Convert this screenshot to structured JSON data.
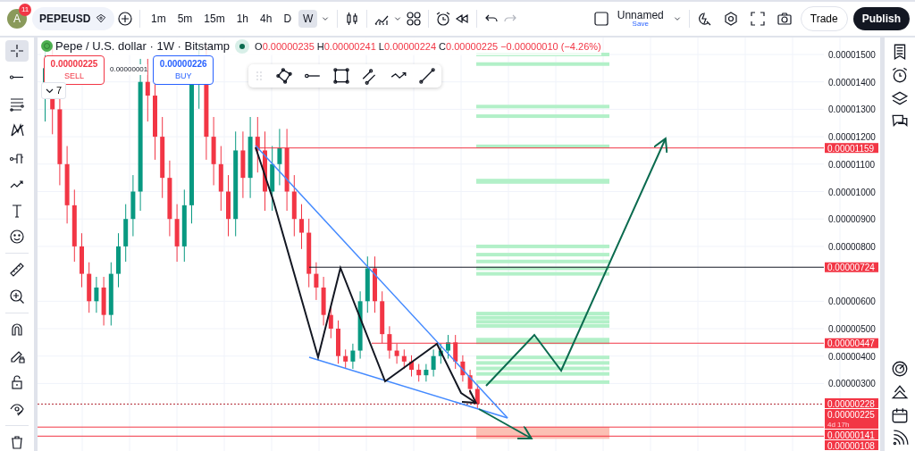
{
  "account": {
    "initial": "A",
    "notifications": "11"
  },
  "symbol": {
    "value": "PEPEUSD"
  },
  "timeframes": [
    {
      "label": "1m",
      "selected": false
    },
    {
      "label": "5m",
      "selected": false
    },
    {
      "label": "15m",
      "selected": false
    },
    {
      "label": "1h",
      "selected": false
    },
    {
      "label": "4h",
      "selected": false
    },
    {
      "label": "D",
      "selected": false
    },
    {
      "label": "W",
      "selected": true
    }
  ],
  "layout": {
    "name": "Unnamed",
    "save": "Save"
  },
  "buttons": {
    "trade": "Trade",
    "publish": "Publish"
  },
  "left_toolbar": [
    {
      "selected": true
    },
    {
      "selected": false
    },
    {
      "selected": false
    },
    {
      "selected": false
    },
    {
      "selected": false
    },
    {
      "selected": false
    },
    {
      "selected": false
    },
    {
      "selected": false
    },
    {
      "selected": false
    },
    {
      "selected": false
    },
    {
      "selected": false
    },
    {
      "selected": false
    },
    {
      "selected": false
    },
    {
      "selected": false
    },
    {
      "selected": false
    }
  ],
  "legend": {
    "title": "Pepe / U.S. dollar · 1W · Bitstamp",
    "ohlc": [
      {
        "key": "O",
        "value": "0.00000235"
      },
      {
        "key": "H",
        "value": "0.00000241"
      },
      {
        "key": "L",
        "value": "0.00000224"
      },
      {
        "key": "C",
        "value": "0.00000225"
      }
    ],
    "change": "−0.00000010 (−4.26%)"
  },
  "order": {
    "sell_price": "0.00000225",
    "sell": "SELL",
    "spread": "0.00000001",
    "buy_price": "0.00000226",
    "buy": "BUY"
  },
  "indicators_count": "7",
  "price_axis": [
    "0.00001500",
    "0.00001400",
    "0.00001300",
    "0.00001200",
    "0.00001100",
    "0.00001000",
    "0.00000900",
    "0.00000800",
    "0.00000600",
    "0.00000500",
    "0.00000400",
    "0.00000300"
  ],
  "price_tags": [
    {
      "label": "0.00001159"
    },
    {
      "label": "0.00000724"
    },
    {
      "label": "0.00000447"
    },
    {
      "label": "0.00000228"
    },
    {
      "label": "0.00000225",
      "countdown": "4d 17h"
    },
    {
      "label": "0.00000141"
    },
    {
      "label": "0.00000108"
    }
  ]
}
